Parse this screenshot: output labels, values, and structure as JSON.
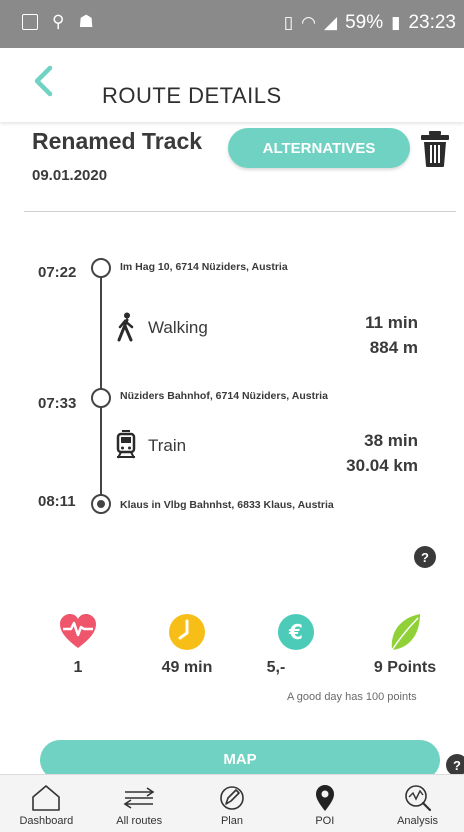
{
  "status_bar": {
    "battery": "59%",
    "time": "23:23",
    "icons_left": [
      "code-icon",
      "usb-icon",
      "android-icon"
    ],
    "icons_right": [
      "vibrate-icon",
      "wifi-icon",
      "signal-icon",
      "battery-icon"
    ]
  },
  "header": {
    "title": "ROUTE DETAILS",
    "back_icon": "chevron-left-icon"
  },
  "track": {
    "name": "Renamed Track",
    "date": "09.01.2020",
    "alternatives_label": "ALTERNATIVES"
  },
  "route": {
    "stops": [
      {
        "time": "07:22",
        "address": "Im Hag 10, 6714 Nüziders, Austria"
      },
      {
        "time": "07:33",
        "address": "Nüziders Bahnhof, 6714 Nüziders, Austria"
      },
      {
        "time": "08:11",
        "address": "Klaus in Vlbg Bahnhst, 6833 Klaus, Austria"
      }
    ],
    "legs": [
      {
        "mode": "Walking",
        "duration": "11 min",
        "distance": "884 m",
        "icon": "walking-icon"
      },
      {
        "mode": "Train",
        "duration": "38 min",
        "distance": "30.04 km",
        "icon": "train-icon"
      }
    ]
  },
  "help_label": "?",
  "stats": {
    "health": "1",
    "time": "49 min",
    "cost": "5,-",
    "points": "9 Points",
    "points_note": "A good day has 100 points"
  },
  "map_button_label": "MAP",
  "bottom_nav": {
    "items": [
      {
        "label": "Dashboard",
        "icon": "home-icon"
      },
      {
        "label": "All routes",
        "icon": "routes-icon"
      },
      {
        "label": "Plan",
        "icon": "pen-icon"
      },
      {
        "label": "POI",
        "icon": "map-pin-icon"
      },
      {
        "label": "Analysis",
        "icon": "analysis-icon"
      }
    ]
  },
  "colors": {
    "accent": "#6fd2c2",
    "heart": "#f0566b",
    "clock": "#f7be17",
    "euro": "#4ccbb8",
    "leaf": "#8fd136",
    "status_bar": "#8a8a8a"
  }
}
